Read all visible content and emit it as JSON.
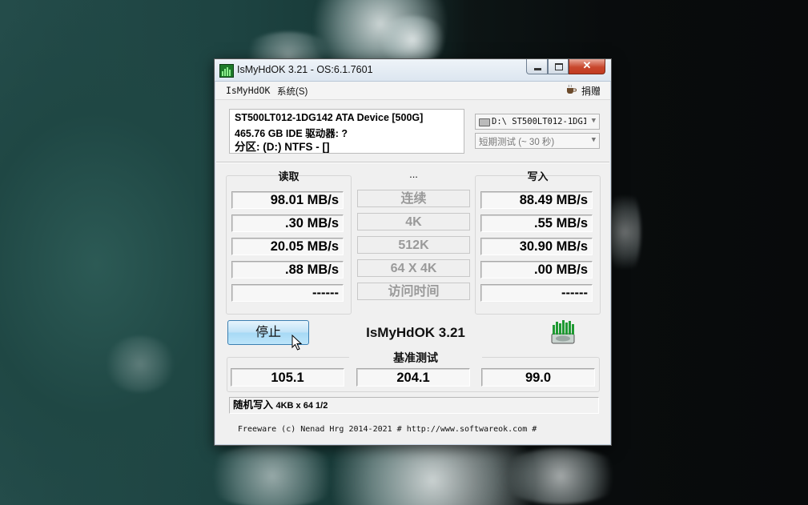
{
  "window": {
    "title": "IsMyHdOK 3.21 - OS:6.1.7601",
    "min_glyph": "",
    "max_glyph": "",
    "close_glyph": "✕"
  },
  "menu": {
    "item1": "IsMyHdOK",
    "item2": "系统(S)",
    "donate": "捐赠"
  },
  "drive": {
    "line1": "ST500LT012-1DG142 ATA Device [500G]",
    "line2": "465.76 GB  IDE 驱动器: ?",
    "line3": "分区: (D:) NTFS - []",
    "selector_value": "D:\\ ST500LT012-1DG1·",
    "duration_value": "短期测试 (~ 30 秒)"
  },
  "results": {
    "read_header": "读取",
    "middle_header": "...",
    "write_header": "写入",
    "labels": [
      "连续",
      "4K",
      "512K",
      "64 X 4K",
      "访问时间"
    ],
    "read": [
      "98.01 MB/s",
      ".30 MB/s",
      "20.05 MB/s",
      ".88 MB/s",
      "------"
    ],
    "write": [
      "88.49 MB/s",
      ".55 MB/s",
      "30.90 MB/s",
      ".00 MB/s",
      "------"
    ]
  },
  "controls": {
    "stop_label": "停止",
    "app_name": "IsMyHdOK 3.21"
  },
  "benchmark": {
    "header": "基准测试",
    "values": [
      "105.1",
      "204.1",
      "99.0"
    ]
  },
  "status": {
    "text": "随机写入",
    "detail": "4KB x 64 1/2"
  },
  "footer": {
    "text": "Freeware (c) Nenad Hrg 2014-2021 # http://www.softwareok.com   #"
  },
  "icons": {
    "app": "hdd-bars-icon",
    "donate": "coffee-cup-icon",
    "drive": "drive-icon",
    "cursor": "mouse-cursor-icon"
  }
}
